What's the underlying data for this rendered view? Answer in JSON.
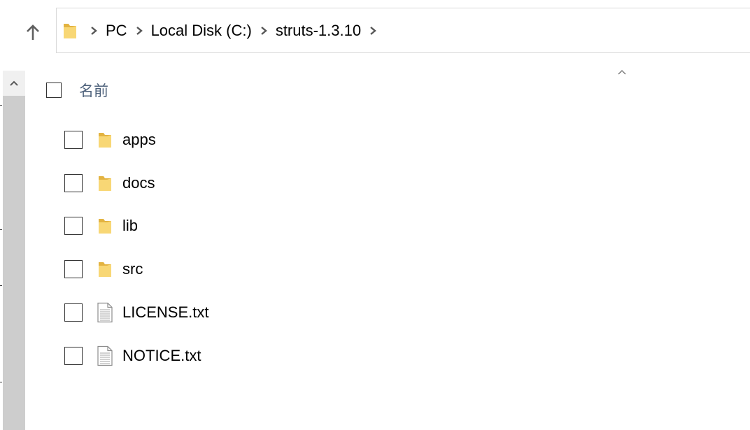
{
  "navigation": {
    "up_icon": "arrow-up-icon",
    "address_folder_icon": "folder-icon",
    "separator_icon": "chevron-right-icon",
    "breadcrumbs": [
      "PC",
      "Local Disk (C:)",
      "struts-1.3.10"
    ]
  },
  "file_list": {
    "header": {
      "name_label": "名前",
      "sort_icon": "chevron-up-icon"
    },
    "items": [
      {
        "name": "apps",
        "type": "folder",
        "icon": "folder-icon"
      },
      {
        "name": "docs",
        "type": "folder",
        "icon": "folder-icon"
      },
      {
        "name": "lib",
        "type": "folder",
        "icon": "folder-icon"
      },
      {
        "name": "src",
        "type": "folder",
        "icon": "folder-icon"
      },
      {
        "name": "LICENSE.txt",
        "type": "text file",
        "icon": "text-file-icon"
      },
      {
        "name": "NOTICE.txt",
        "type": "text file",
        "icon": "text-file-icon"
      }
    ]
  },
  "colors": {
    "folder_yellow": "#f8d775",
    "folder_dark": "#e3b341",
    "header_text": "#4c607a",
    "scrollbar": "#cdcdcd"
  }
}
